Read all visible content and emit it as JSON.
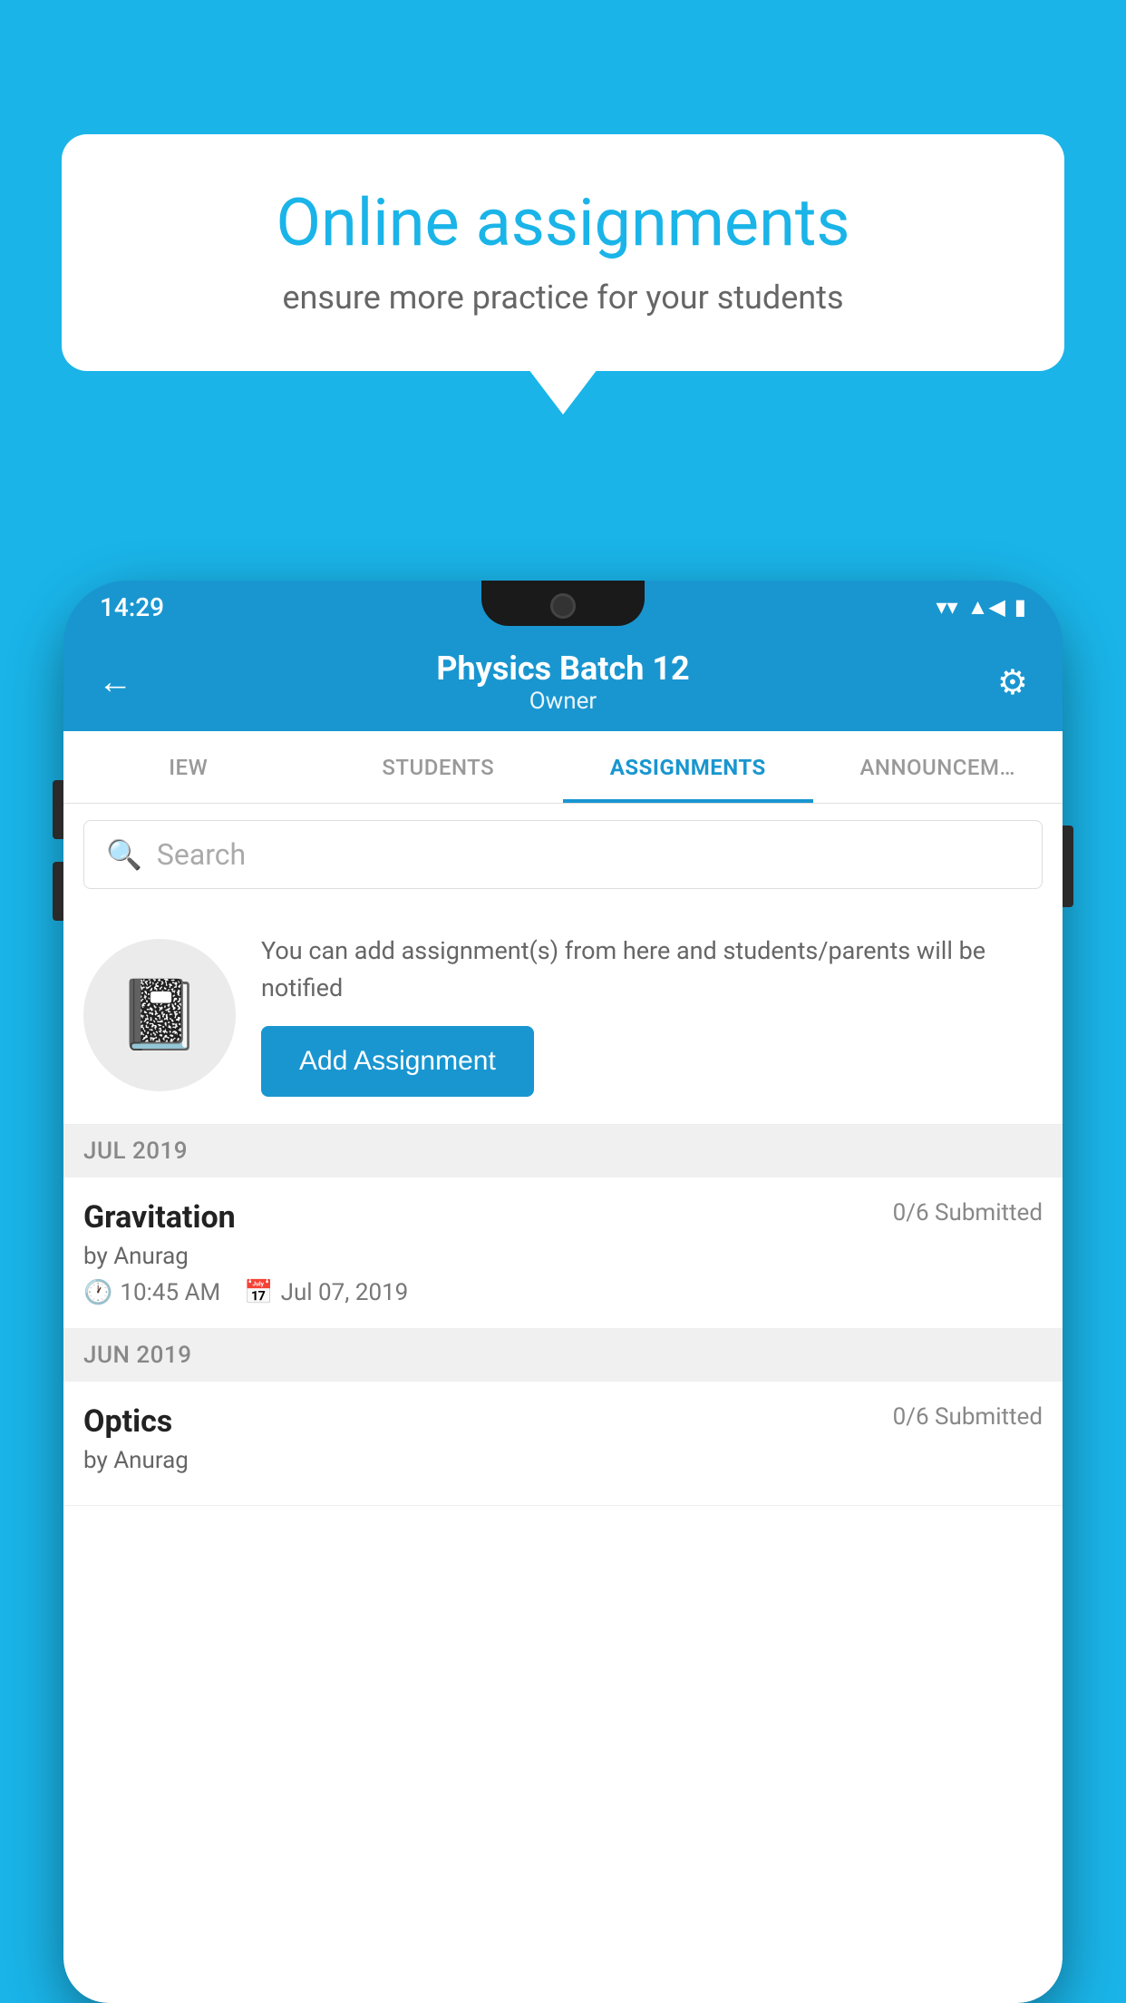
{
  "background": {
    "color": "#1ab4e8"
  },
  "speech_bubble": {
    "title": "Online assignments",
    "subtitle": "ensure more practice for your students"
  },
  "status_bar": {
    "time": "14:29",
    "icons": [
      "wifi",
      "signal",
      "battery"
    ]
  },
  "app_header": {
    "title": "Physics Batch 12",
    "subtitle": "Owner",
    "back_label": "←",
    "settings_label": "⚙"
  },
  "tabs": [
    {
      "label": "IEW",
      "active": false
    },
    {
      "label": "STUDENTS",
      "active": false
    },
    {
      "label": "ASSIGNMENTS",
      "active": true
    },
    {
      "label": "ANNOUNCEM…",
      "active": false
    }
  ],
  "search": {
    "placeholder": "Search"
  },
  "promo": {
    "description": "You can add assignment(s) from here and students/parents will be notified",
    "button_label": "Add Assignment"
  },
  "sections": [
    {
      "month_label": "JUL 2019",
      "assignments": [
        {
          "name": "Gravitation",
          "submitted": "0/6 Submitted",
          "by": "by Anurag",
          "time": "10:45 AM",
          "date": "Jul 07, 2019"
        }
      ]
    },
    {
      "month_label": "JUN 2019",
      "assignments": [
        {
          "name": "Optics",
          "submitted": "0/6 Submitted",
          "by": "by Anurag",
          "time": "",
          "date": ""
        }
      ]
    }
  ]
}
